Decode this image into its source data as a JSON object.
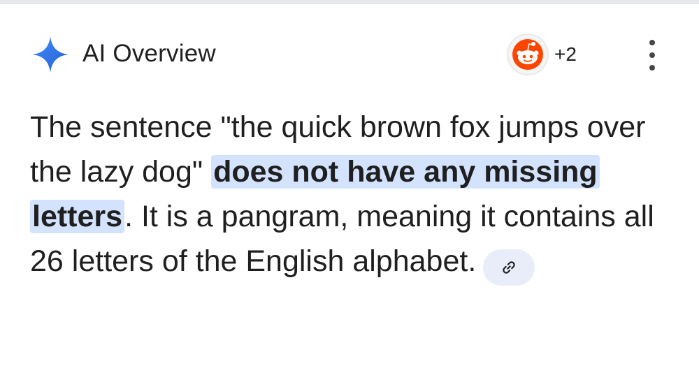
{
  "overview": {
    "title": "AI Overview",
    "sources_extra_count": "+2",
    "source_icon": "reddit-icon",
    "menu_icon": "more-vert-icon"
  },
  "answer": {
    "part1": "The sentence \"the quick brown fox jumps over the lazy dog\" ",
    "highlight": "does not have any missing letters",
    "part2": ". It is a pangram, meaning it contains all 26 letters of the English alphabet.",
    "link_icon": "link-icon"
  },
  "colors": {
    "sparkle": "#2f6fe6",
    "highlight_bg": "#d3e3fd",
    "reddit": "#ff4500",
    "text": "#1f1f1f"
  }
}
